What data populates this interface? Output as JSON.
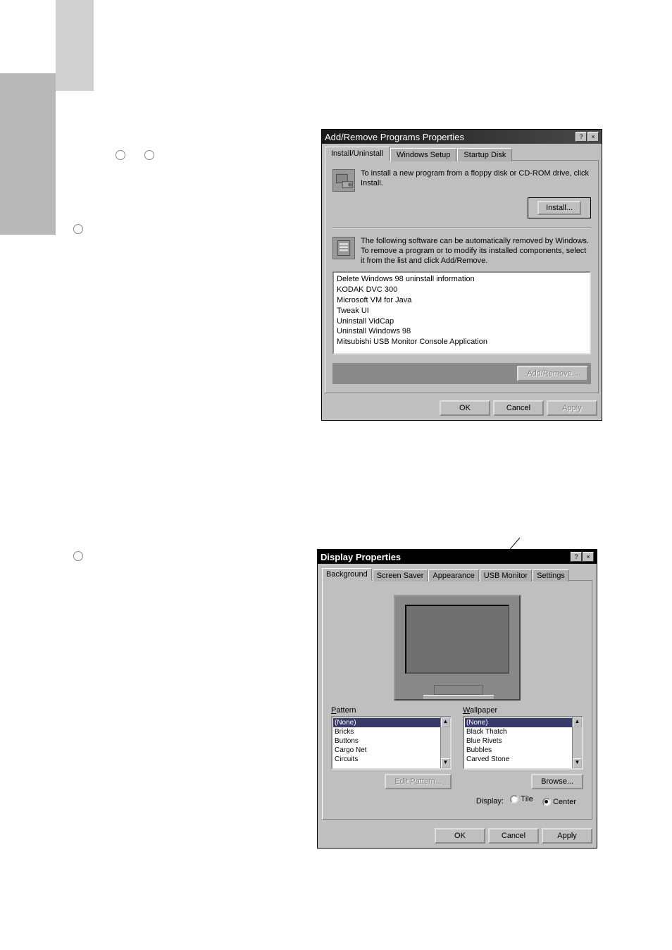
{
  "dialog1": {
    "title": "Add/Remove Programs Properties",
    "tabs": [
      "Install/Uninstall",
      "Windows Setup",
      "Startup Disk"
    ],
    "active_tab": 0,
    "install_desc": "To install a new program from a floppy disk or CD-ROM drive, click Install.",
    "install_btn": "Install...",
    "remove_desc": "The following software can be automatically removed by Windows. To remove a program or to modify its installed components, select it from the list and click Add/Remove.",
    "programs": [
      "Delete Windows 98 uninstall information",
      "KODAK DVC 300",
      "Microsoft VM for Java",
      "Tweak UI",
      "Uninstall VidCap",
      "Uninstall Windows 98",
      "Mitsubishi USB Monitor Console Application"
    ],
    "addremove_btn": "Add/Remove...",
    "ok": "OK",
    "cancel": "Cancel",
    "apply": "Apply"
  },
  "dialog2": {
    "title": "Display Properties",
    "tabs": [
      "Background",
      "Screen Saver",
      "Appearance",
      "USB Monitor",
      "Settings"
    ],
    "active_tab": 0,
    "pattern_label": "Pattern",
    "wallpaper_label": "Wallpaper",
    "patterns": [
      "(None)",
      "Bricks",
      "Buttons",
      "Cargo Net",
      "Circuits"
    ],
    "wallpapers": [
      "(None)",
      "Black Thatch",
      "Blue Rivets",
      "Bubbles",
      "Carved Stone"
    ],
    "edit_pattern_btn": "Edit Pattern...",
    "browse_btn": "Browse...",
    "display_label": "Display:",
    "tile": "Tile",
    "center": "Center",
    "ok": "OK",
    "cancel": "Cancel",
    "apply": "Apply"
  }
}
